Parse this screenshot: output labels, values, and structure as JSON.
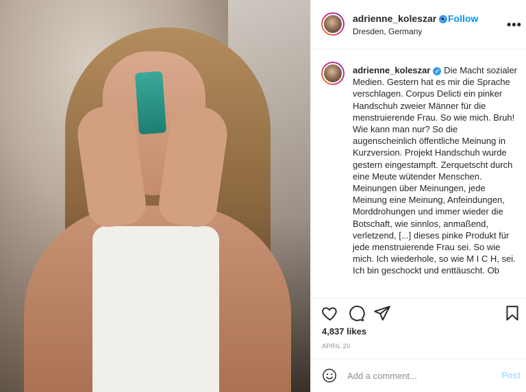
{
  "post": {
    "username": "adrienne_koleszar",
    "location": "Dresden, Germany",
    "follow_label": "Follow",
    "dot": "•",
    "more_label": "•••",
    "caption": "Die Macht sozialer Medien. Gestern hat es mir die Sprache verschlagen. Corpus Delicti ein pinker Handschuh zweier Männer für die menstruierende Frau. So wie mich. Bruh! Wie kann man nur? So die augenscheinlich öffentliche Meinung in Kurzversion. Projekt Handschuh wurde gestern eingestampft. Zerquetscht durch eine Meute wütender Menschen. Meinungen über Meinungen, jede Meinung eine Meinung, Anfeindungen, Morddrohungen und immer wieder die Botschaft, wie sinnlos, anmaßend, verletzend, [...] dieses pinke Produkt für jede menstruierende Frau sei. So wie mich. Ich wiederhole, so wie M I C H, sei. Ich bin geschockt und enttäuscht. Ob",
    "likes": "4,837 likes",
    "date": "APRIL 20"
  },
  "comment": {
    "placeholder": "Add a comment...",
    "post_label": "Post"
  },
  "icons": {
    "like": "heart-icon",
    "comment": "comment-icon",
    "share": "paper-plane-icon",
    "save": "bookmark-icon",
    "emoji": "smiley-icon",
    "verified": "verified-badge-icon"
  },
  "colors": {
    "accent": "#0095f6",
    "verified": "#3897f0",
    "post_disabled": "#b3dbff"
  }
}
